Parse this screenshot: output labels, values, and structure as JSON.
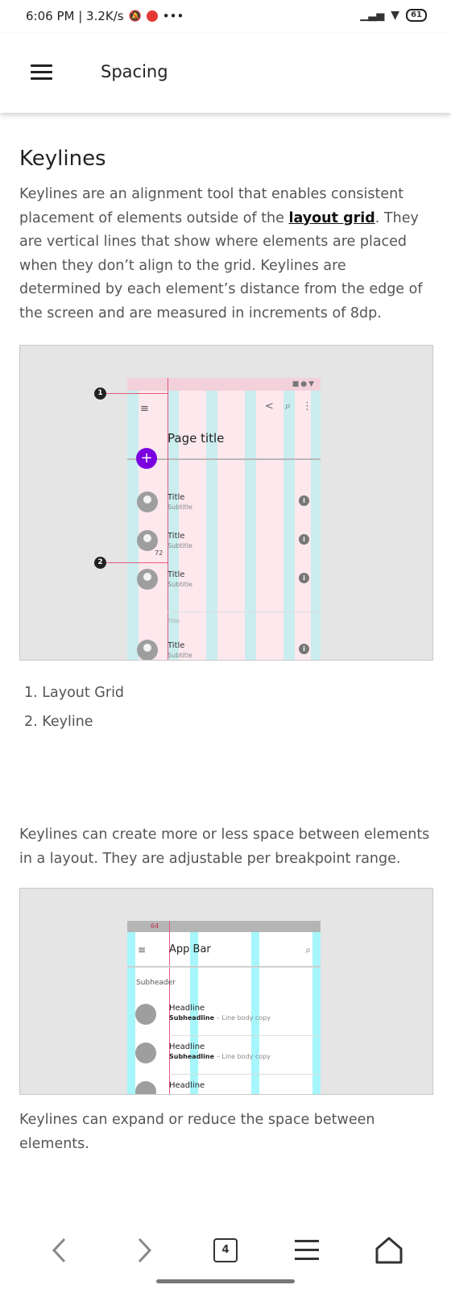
{
  "status_bar": {
    "time_speed": "6:06 PM | 3.2K/s",
    "more": "•••",
    "battery": "61"
  },
  "app_bar": {
    "title": "Spacing"
  },
  "section": {
    "heading": "Keylines",
    "intro_before": "Keylines are an alignment tool that enables consistent placement of elements outside of the ",
    "intro_link": "layout grid",
    "intro_after": ". They are vertical lines that show where elements are placed when they don’t align to the grid. Keylines are determined by each element’s distance from the edge of the screen and are measured in increments of 8dp."
  },
  "figure1": {
    "page_title": "Page title",
    "fab": "+",
    "callouts": [
      "1",
      "2"
    ],
    "measure": "72",
    "list": [
      {
        "title": "Title",
        "subtitle": "Subtitle"
      },
      {
        "title": "Title",
        "subtitle": "Subtitle"
      },
      {
        "title": "Title",
        "subtitle": "Subtitle"
      }
    ],
    "subheader": "Title",
    "last_title": "Title",
    "last_subtitle": "Subtitle"
  },
  "legend": [
    "1. Layout Grid",
    "2. Keyline"
  ],
  "paragraph2": "Keylines can create more or less space between elements in a layout. They are adjustable per breakpoint range.",
  "figure2": {
    "measure": "64",
    "title": "App Bar",
    "subheader": "Subheader",
    "rows": [
      {
        "headline": "Headline",
        "subheadline": "Subheadline",
        "body": "– Line body copy"
      },
      {
        "headline": "Headline",
        "subheadline": "Subheadline",
        "body": "– Line body copy"
      },
      {
        "headline": "Headline"
      }
    ]
  },
  "paragraph3": "Keylines can expand or reduce the space between elements.",
  "bottom_nav": {
    "tabs_count": "4"
  },
  "colors": {
    "fab": "#7b00e0",
    "grid_column": "#a0f0f0",
    "grid_gutter": "#fde8ee",
    "keyline": "#e45a7a"
  }
}
